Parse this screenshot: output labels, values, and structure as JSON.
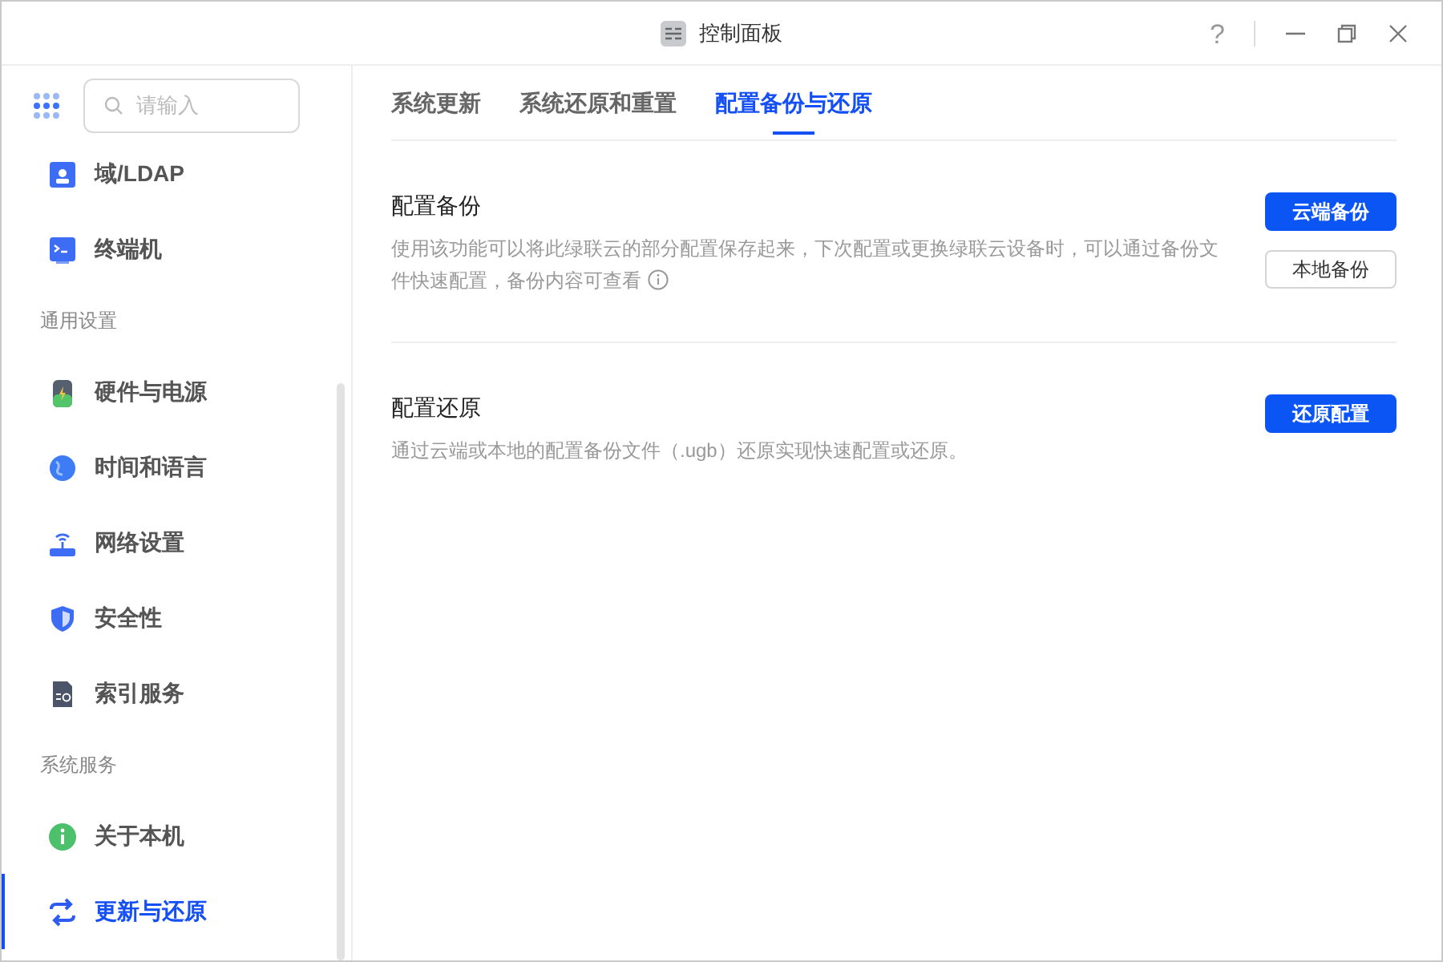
{
  "window": {
    "title": "控制面板",
    "help": "?"
  },
  "search": {
    "placeholder": "请输入"
  },
  "sidebar": {
    "items": [
      {
        "kind": "item",
        "label": "域/LDAP",
        "selected": false
      },
      {
        "kind": "item",
        "label": "终端机",
        "selected": false
      },
      {
        "kind": "section",
        "label": "通用设置"
      },
      {
        "kind": "item",
        "label": "硬件与电源",
        "selected": false
      },
      {
        "kind": "item",
        "label": "时间和语言",
        "selected": false
      },
      {
        "kind": "item",
        "label": "网络设置",
        "selected": false
      },
      {
        "kind": "item",
        "label": "安全性",
        "selected": false
      },
      {
        "kind": "item",
        "label": "索引服务",
        "selected": false
      },
      {
        "kind": "section",
        "label": "系统服务"
      },
      {
        "kind": "item",
        "label": "关于本机",
        "selected": false
      },
      {
        "kind": "item",
        "label": "更新与还原",
        "selected": true
      }
    ]
  },
  "tabs": [
    {
      "label": "系统更新",
      "selected": false
    },
    {
      "label": "系统还原和重置",
      "selected": false
    },
    {
      "label": "配置备份与还原",
      "selected": true
    }
  ],
  "sections": [
    {
      "title": "配置备份",
      "description": "使用该功能可以将此绿联云的部分配置保存起来，下次配置或更换绿联云设备时，可以通过备份文件快速配置，备份内容可查看",
      "info": true,
      "buttons": [
        {
          "label": "云端备份",
          "primary": true
        },
        {
          "label": "本地备份",
          "primary": false
        }
      ]
    },
    {
      "title": "配置还原",
      "description": "通过云端或本地的配置备份文件（.ugb）还原实现快速配置或还原。",
      "info": false,
      "buttons": [
        {
          "label": "还原配置",
          "primary": true
        }
      ]
    }
  ]
}
